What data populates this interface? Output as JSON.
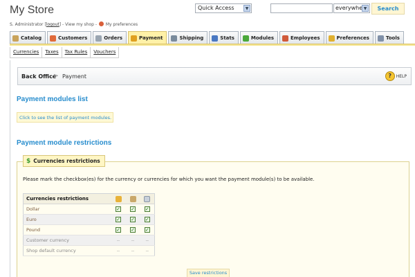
{
  "header": {
    "store_title": "My Store",
    "user_name": "S. Administrator",
    "logout_label": "logout",
    "view_shop_label": "View my shop",
    "preferences_label": "My preferences",
    "quick_access": "Quick Access",
    "search_scope": "everywhere",
    "search_button": "Search"
  },
  "tabs": [
    {
      "label": "Catalog",
      "icon": "catalog-icon",
      "color": "#c9a35b"
    },
    {
      "label": "Customers",
      "icon": "customers-icon",
      "color": "#e06a3a"
    },
    {
      "label": "Orders",
      "icon": "orders-icon",
      "color": "#9aa5b1"
    },
    {
      "label": "Payment",
      "icon": "payment-icon",
      "color": "#e0a020",
      "active": true
    },
    {
      "label": "Shipping",
      "icon": "shipping-icon",
      "color": "#7a8b9c"
    },
    {
      "label": "Stats",
      "icon": "stats-icon",
      "color": "#4a78c2"
    },
    {
      "label": "Modules",
      "icon": "modules-icon",
      "color": "#4aa83a"
    },
    {
      "label": "Employees",
      "icon": "employees-icon",
      "color": "#d05a3a"
    },
    {
      "label": "Preferences",
      "icon": "preferences-icon",
      "color": "#e0b030"
    },
    {
      "label": "Tools",
      "icon": "tools-icon",
      "color": "#8090a8"
    }
  ],
  "subtabs": [
    "Currencies",
    "Taxes",
    "Tax Rules",
    "Vouchers"
  ],
  "breadcrumb": {
    "root": "Back Office",
    "current": "Payment",
    "help_label": "HELP"
  },
  "payment_list": {
    "title": "Payment modules list",
    "info_link": "Click to see the list of payment modules."
  },
  "restrictions": {
    "title": "Payment module restrictions",
    "legend": "Currencies restrictions",
    "instructions": "Please mark the checkbox(es) for the currency or currencies for which you want the payment module(s) to be available.",
    "table_header": "Currencies restrictions",
    "column_icons": [
      "cheque-module-icon",
      "wire-module-icon",
      "cod-module-icon"
    ],
    "rows": [
      {
        "label": "Dollar",
        "cells": [
          "checked",
          "checked",
          "checked"
        ]
      },
      {
        "label": "Euro",
        "cells": [
          "checked",
          "checked",
          "checked"
        ]
      },
      {
        "label": "Pound",
        "cells": [
          "checked",
          "checked",
          "checked"
        ]
      },
      {
        "label": "Customer currency",
        "cells": [
          "--",
          "--",
          "--"
        ]
      },
      {
        "label": "Shop default currency",
        "cells": [
          "--",
          "--",
          "--"
        ]
      }
    ],
    "save_button": "Save restrictions"
  },
  "colors": {
    "accent_blue": "#268ccd",
    "active_tab": "#fff1a8",
    "panel_bg": "#fffdf0"
  }
}
